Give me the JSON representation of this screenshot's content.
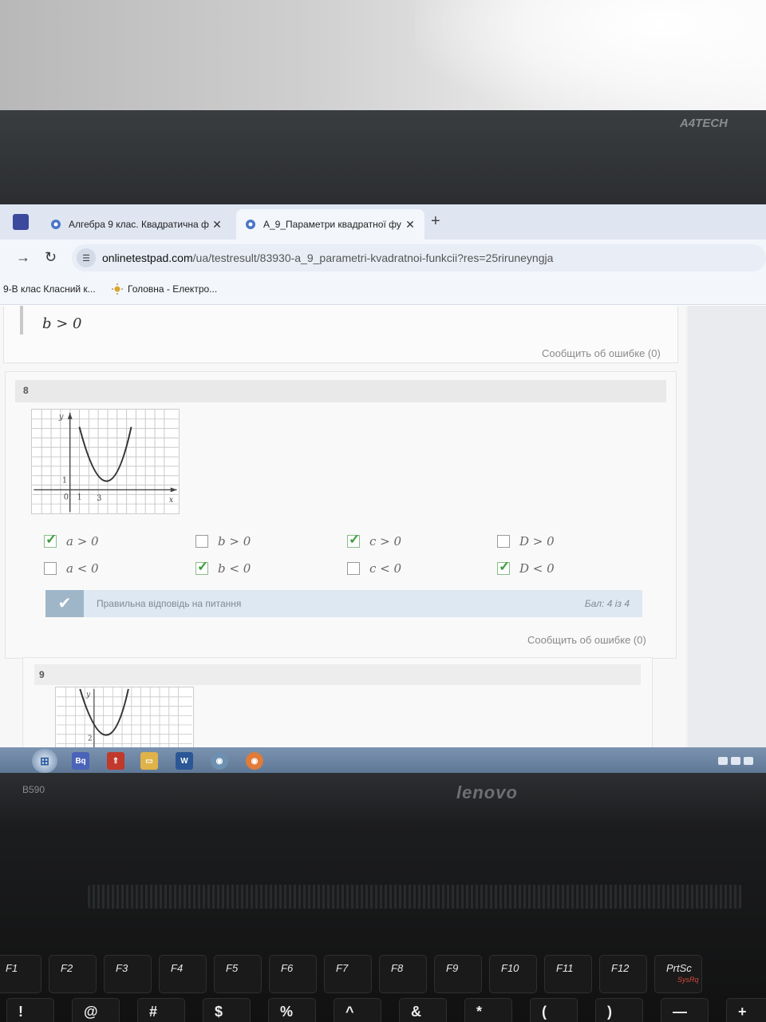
{
  "monitor": {
    "brand": "A4TECH"
  },
  "browser": {
    "tabs": [
      {
        "title": "Алгебра 9 клас. Квадратична ф",
        "active": false
      },
      {
        "title": "А_9_Параметри квадратної фу",
        "active": true
      }
    ],
    "url_domain": "onlinetestpad.com",
    "url_path": "/ua/testresult/83930-a_9_parametri-kvadratnoi-funkcii?res=25riruneyngja",
    "bookmarks": [
      {
        "label": "9-В клас Класний к..."
      },
      {
        "label": "Головна - Електро..."
      }
    ]
  },
  "previous_question": {
    "answer": "b > 0",
    "report_link": "Сообщить об ошибке (0)"
  },
  "question": {
    "number": "8",
    "graph": {
      "y_label": "y",
      "x_label": "x",
      "tick_x1": "1",
      "tick_x3": "3",
      "tick_y1": "1",
      "origin": "0"
    },
    "options": [
      {
        "label": "a > 0",
        "checked": true
      },
      {
        "label": "b > 0",
        "checked": false
      },
      {
        "label": "c > 0",
        "checked": true
      },
      {
        "label": "D > 0",
        "checked": false
      },
      {
        "label": "a < 0",
        "checked": false
      },
      {
        "label": "b < 0",
        "checked": true
      },
      {
        "label": "c < 0",
        "checked": false
      },
      {
        "label": "D < 0",
        "checked": true
      }
    ],
    "result_text": "Правильна відповідь на питання",
    "score_label": "Бал:",
    "score": "4",
    "score_of": "із",
    "score_max": "4",
    "report_link": "Сообщить об ошибке (0)"
  },
  "next_question": {
    "number": "9",
    "graph": {
      "y_label": "y",
      "tick_y": "2"
    }
  },
  "laptop": {
    "model": "B590",
    "brand": "lenovo",
    "fkeys": [
      {
        "label": "F1",
        "sub": ""
      },
      {
        "label": "F2",
        "sub": ""
      },
      {
        "label": "F3",
        "sub": ""
      },
      {
        "label": "F4",
        "sub": ""
      },
      {
        "label": "F5",
        "sub": ""
      },
      {
        "label": "F6",
        "sub": ""
      },
      {
        "label": "F7",
        "sub": ""
      },
      {
        "label": "F8",
        "sub": ""
      },
      {
        "label": "F9",
        "sub": ""
      },
      {
        "label": "F10",
        "sub": ""
      },
      {
        "label": "F11",
        "sub": ""
      },
      {
        "label": "F12",
        "sub": ""
      },
      {
        "label": "PrtSc",
        "sub": "SysRq"
      }
    ],
    "number_keys": [
      "!",
      "@",
      "#",
      "$",
      "%",
      "^",
      "&",
      "*",
      "(",
      ")",
      "—",
      "+"
    ]
  }
}
